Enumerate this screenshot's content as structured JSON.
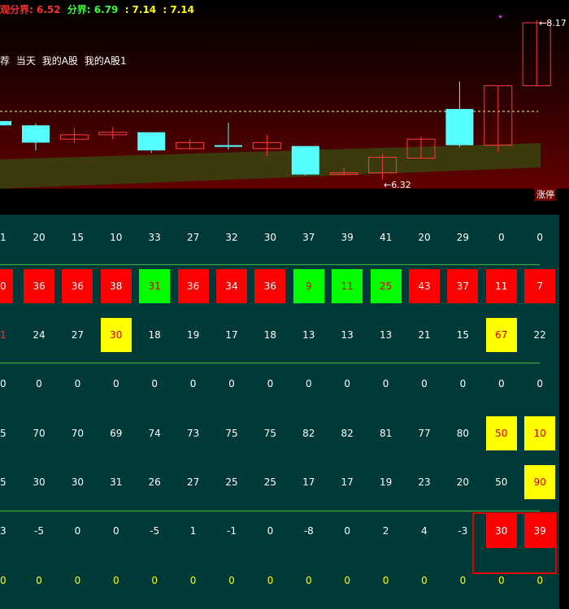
{
  "header": {
    "label1": "观分界: 6.52",
    "label2": "分界: 6.79",
    "label3": ": 7.14",
    "label4": ": 7.14",
    "colors": {
      "label1": "#ff3030",
      "label2": "#33ff33",
      "label3": "#ffff00",
      "label4": "#ffff00"
    }
  },
  "strategy_labels": [
    "荐",
    "当天",
    "我的A股",
    "我的A股1"
  ],
  "price_labels": {
    "high": "8.17",
    "low": "6.32",
    "zhangting": "涨停"
  },
  "colors": {
    "bull_candle": "#ff3a3a",
    "bear_candle": "#55ffff",
    "table_bg": "#003a38",
    "cell_red": "#ff0000",
    "cell_green": "#00ff00",
    "cell_yellow": "#ffff00",
    "divider": "#37b83a",
    "highlight_border": "#e00000"
  },
  "candles": [
    {
      "o": 7.0,
      "c": 6.95,
      "h": 7.0,
      "l": 6.95,
      "type": "bear"
    },
    {
      "o": 6.95,
      "c": 6.75,
      "h": 6.97,
      "l": 6.66,
      "type": "bear"
    },
    {
      "o": 6.79,
      "c": 6.84,
      "h": 6.92,
      "l": 6.74,
      "type": "bull"
    },
    {
      "o": 6.84,
      "c": 6.87,
      "h": 6.93,
      "l": 6.79,
      "type": "bull"
    },
    {
      "o": 6.87,
      "c": 6.66,
      "h": 6.87,
      "l": 6.63,
      "type": "bear"
    },
    {
      "o": 6.68,
      "c": 6.75,
      "h": 6.79,
      "l": 6.68,
      "type": "bull"
    },
    {
      "o": 6.72,
      "c": 6.71,
      "h": 6.98,
      "l": 6.67,
      "type": "bear"
    },
    {
      "o": 6.68,
      "c": 6.75,
      "h": 6.84,
      "l": 6.59,
      "type": "bull"
    },
    {
      "o": 6.71,
      "c": 6.38,
      "h": 6.71,
      "l": 6.37,
      "type": "bear"
    },
    {
      "o": 6.38,
      "c": 6.4,
      "h": 6.46,
      "l": 6.37,
      "type": "bull"
    },
    {
      "o": 6.4,
      "c": 6.58,
      "h": 6.62,
      "l": 6.32,
      "type": "bull"
    },
    {
      "o": 6.57,
      "c": 6.79,
      "h": 6.82,
      "l": 6.57,
      "type": "bull"
    },
    {
      "o": 6.72,
      "c": 7.14,
      "h": 7.46,
      "l": 6.7,
      "type": "bear"
    },
    {
      "o": 6.72,
      "c": 7.41,
      "h": 7.41,
      "l": 6.64,
      "type": "bull"
    },
    {
      "o": 7.41,
      "c": 8.14,
      "h": 8.17,
      "l": 7.41,
      "type": "bull"
    }
  ],
  "rows": [
    {
      "cells": [
        {
          "v": "1"
        },
        {
          "v": "20"
        },
        {
          "v": "15"
        },
        {
          "v": "10"
        },
        {
          "v": "33"
        },
        {
          "v": "27"
        },
        {
          "v": "32"
        },
        {
          "v": "30"
        },
        {
          "v": "37"
        },
        {
          "v": "39"
        },
        {
          "v": "41"
        },
        {
          "v": "20"
        },
        {
          "v": "29"
        },
        {
          "v": "0"
        },
        {
          "v": "0"
        }
      ]
    },
    {
      "cells": [
        {
          "v": "0",
          "s": "red"
        },
        {
          "v": "36",
          "s": "red"
        },
        {
          "v": "36",
          "s": "red"
        },
        {
          "v": "38",
          "s": "red"
        },
        {
          "v": "31",
          "s": "green"
        },
        {
          "v": "36",
          "s": "red"
        },
        {
          "v": "34",
          "s": "red"
        },
        {
          "v": "36",
          "s": "red"
        },
        {
          "v": "9",
          "s": "green"
        },
        {
          "v": "11",
          "s": "green"
        },
        {
          "v": "25",
          "s": "green"
        },
        {
          "v": "43",
          "s": "red"
        },
        {
          "v": "37",
          "s": "red"
        },
        {
          "v": "11",
          "s": "red"
        },
        {
          "v": "7",
          "s": "red"
        }
      ]
    },
    {
      "cells": [
        {
          "v": "1",
          "s": "redtext"
        },
        {
          "v": "24"
        },
        {
          "v": "27"
        },
        {
          "v": "30",
          "s": "yellow"
        },
        {
          "v": "18"
        },
        {
          "v": "19"
        },
        {
          "v": "17"
        },
        {
          "v": "18"
        },
        {
          "v": "13"
        },
        {
          "v": "13"
        },
        {
          "v": "13"
        },
        {
          "v": "21"
        },
        {
          "v": "15"
        },
        {
          "v": "67",
          "s": "yellow"
        },
        {
          "v": "22"
        }
      ]
    },
    {
      "cells": [
        {
          "v": "0"
        },
        {
          "v": "0"
        },
        {
          "v": "0"
        },
        {
          "v": "0"
        },
        {
          "v": "0"
        },
        {
          "v": "0"
        },
        {
          "v": "0"
        },
        {
          "v": "0"
        },
        {
          "v": "0"
        },
        {
          "v": "0"
        },
        {
          "v": "0"
        },
        {
          "v": "0"
        },
        {
          "v": "0"
        },
        {
          "v": "0"
        },
        {
          "v": "0"
        }
      ]
    },
    {
      "cells": [
        {
          "v": "5"
        },
        {
          "v": "70"
        },
        {
          "v": "70"
        },
        {
          "v": "69"
        },
        {
          "v": "74"
        },
        {
          "v": "73"
        },
        {
          "v": "75"
        },
        {
          "v": "75"
        },
        {
          "v": "82"
        },
        {
          "v": "82"
        },
        {
          "v": "81"
        },
        {
          "v": "77"
        },
        {
          "v": "80"
        },
        {
          "v": "50",
          "s": "yellow"
        },
        {
          "v": "10",
          "s": "yellow"
        }
      ]
    },
    {
      "cells": [
        {
          "v": "5"
        },
        {
          "v": "30"
        },
        {
          "v": "30"
        },
        {
          "v": "31"
        },
        {
          "v": "26"
        },
        {
          "v": "27"
        },
        {
          "v": "25"
        },
        {
          "v": "25"
        },
        {
          "v": "17"
        },
        {
          "v": "17"
        },
        {
          "v": "19"
        },
        {
          "v": "23"
        },
        {
          "v": "20"
        },
        {
          "v": "50"
        },
        {
          "v": "90",
          "s": "yellow"
        }
      ]
    },
    {
      "cells": [
        {
          "v": "3"
        },
        {
          "v": "-5"
        },
        {
          "v": "0"
        },
        {
          "v": "0"
        },
        {
          "v": "-5"
        },
        {
          "v": "1"
        },
        {
          "v": "-1"
        },
        {
          "v": "0"
        },
        {
          "v": "-8"
        },
        {
          "v": "0"
        },
        {
          "v": "2"
        },
        {
          "v": "4"
        },
        {
          "v": "-3"
        },
        {
          "v": "30",
          "s": "red"
        },
        {
          "v": "39",
          "s": "red"
        }
      ]
    },
    {
      "cells": [
        {
          "v": "0",
          "s": "ytext"
        },
        {
          "v": "0",
          "s": "ytext"
        },
        {
          "v": "0",
          "s": "ytext"
        },
        {
          "v": "0",
          "s": "ytext"
        },
        {
          "v": "0",
          "s": "ytext"
        },
        {
          "v": "0",
          "s": "ytext"
        },
        {
          "v": "0",
          "s": "ytext"
        },
        {
          "v": "0",
          "s": "ytext"
        },
        {
          "v": "0",
          "s": "ytext"
        },
        {
          "v": "0",
          "s": "ytext"
        },
        {
          "v": "0",
          "s": "ytext"
        },
        {
          "v": "0",
          "s": "ytext"
        },
        {
          "v": "0",
          "s": "ytext"
        },
        {
          "v": "0",
          "s": "ytext"
        },
        {
          "v": "0",
          "s": "ytext"
        }
      ]
    }
  ]
}
